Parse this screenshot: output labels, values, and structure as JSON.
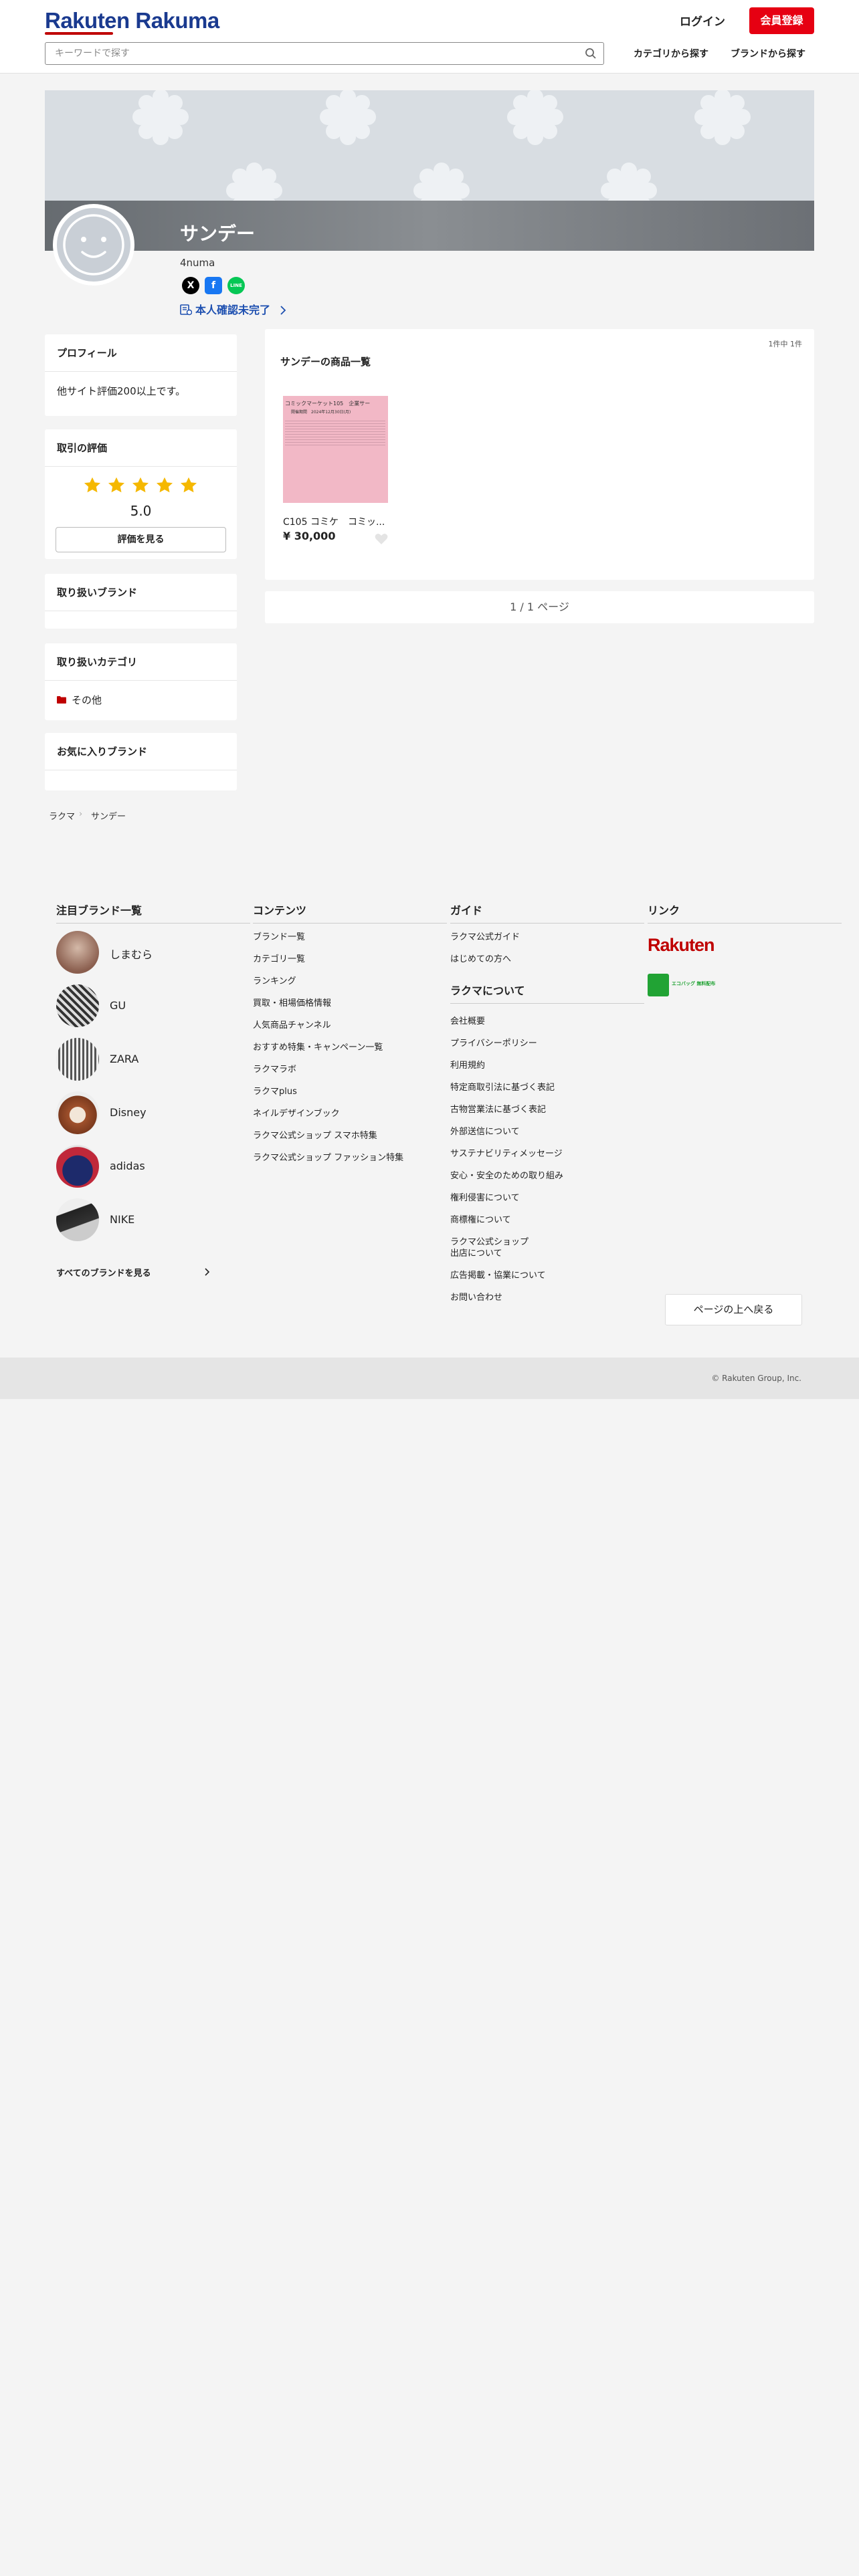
{
  "header": {
    "logo": "Rakuten Rakuma",
    "login": "ログイン",
    "signup": "会員登録",
    "search_placeholder": "キーワードで探す",
    "nav_category": "カテゴリから探す",
    "nav_brand": "ブランドから探す"
  },
  "profile": {
    "name": "サンデー",
    "user_id": "4numa",
    "verify": "本人確認未完了",
    "social": [
      "X",
      "f",
      "LINE"
    ]
  },
  "sidebar": {
    "profile_title": "プロフィール",
    "profile_text": "他サイト評価200以上です。",
    "rating_title": "取引の評価",
    "rating_value": "5.0",
    "rating_stars": 5,
    "rating_button": "評価を見る",
    "brands_title": "取り扱いブランド",
    "categories_title": "取り扱いカテゴリ",
    "category_item": "その他",
    "fav_brands_title": "お気に入りブランド"
  },
  "listing": {
    "count": "1件中 1件",
    "title": "サンデーの商品一覧",
    "items": [
      {
        "name": "C105 コミケ　コミッ...",
        "price": "¥ 30,000",
        "thumb_line1": "コミックマーケット105　企業サー",
        "thumb_line2": "開催期間　2024年12月30日(月)"
      }
    ],
    "pager": "1 / 1 ページ"
  },
  "breadcrumb": [
    "ラクマ",
    "サンデー"
  ],
  "footer": {
    "brands_title": "注目ブランド一覧",
    "brands": [
      "しまむら",
      "GU",
      "ZARA",
      "Disney",
      "adidas",
      "NIKE"
    ],
    "all_brands": "すべてのブランドを見る",
    "contents_title": "コンテンツ",
    "contents": [
      "ブランド一覧",
      "カテゴリ一覧",
      "ランキング",
      "買取・相場価格情報",
      "人気商品チャンネル",
      "おすすめ特集・キャンペーン一覧",
      "ラクマラボ",
      "ラクマplus",
      "ネイルデザインブック",
      "ラクマ公式ショップ スマホ特集",
      "ラクマ公式ショップ ファッション特集"
    ],
    "guide_title": "ガイド",
    "guide": [
      "ラクマ公式ガイド",
      "はじめての方へ"
    ],
    "about_title": "ラクマについて",
    "about": [
      "会社概要",
      "プライバシーポリシー",
      "利用規約",
      "特定商取引法に基づく表記",
      "古物営業法に基づく表記",
      "外部送信について",
      "サステナビリティメッセージ",
      "安心・安全のための取り組み",
      "権利侵害について",
      "商標権について",
      "ラクマ公式ショップ\n出店について",
      "広告掲載・協業について",
      "お問い合わせ"
    ],
    "links_title": "リンク",
    "rakuten_logo": "Rakuten",
    "eco_logo": "エコバッグ 無料配布",
    "to_top": "ページの上へ戻る",
    "copyright": "© Rakuten Group, Inc."
  },
  "colors": {
    "brand_red": "#e60012",
    "brand_blue": "#1a3a8f",
    "star": "#f5b800",
    "link_blue": "#1d4fb0"
  }
}
